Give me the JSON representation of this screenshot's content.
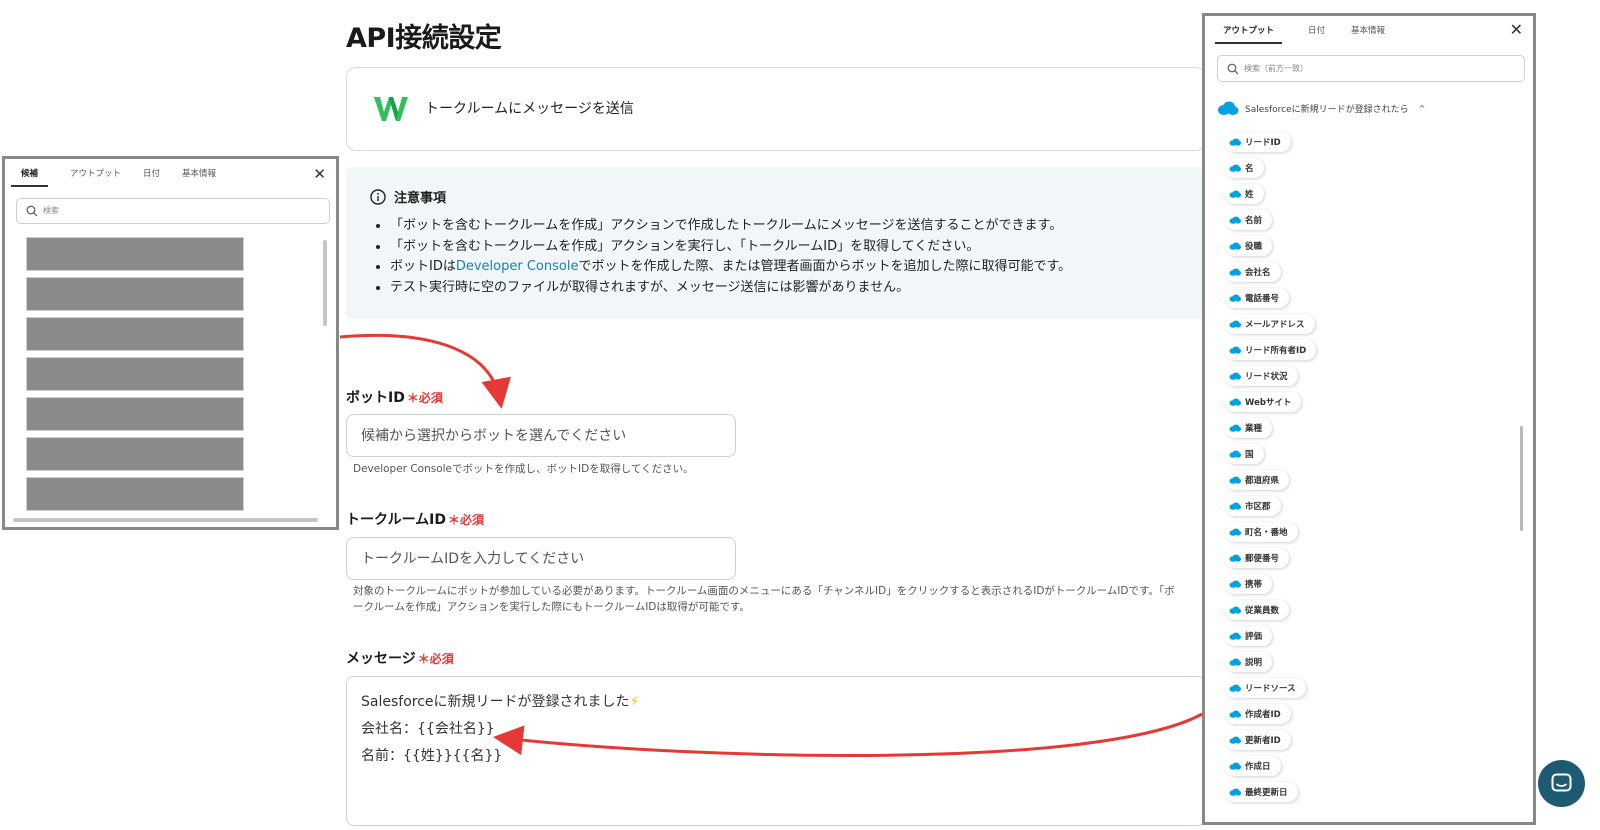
{
  "page": {
    "title": "API接続設定"
  },
  "action": {
    "label": "トークルームにメッセージを送信"
  },
  "notice": {
    "heading": "注意事項",
    "item1": "「ボットを含むトークルームを作成」アクションで作成したトークルームにメッセージを送信することができます。",
    "item2": "「ボットを含むトークルームを作成」アクションを実行し、「トークルームID」を取得してください。",
    "item3_prefix": "ボットIDは",
    "item3_link": "Developer Console",
    "item3_suffix": "でボットを作成した際、または管理者画面からボットを追加した際に取得可能です。",
    "item4": "テスト実行時に空のファイルが取得されますが、メッセージ送信には影響がありません。"
  },
  "form": {
    "bot_id": {
      "label": "ボットID",
      "required": "必須",
      "placeholder": "候補から選択からボットを選んでください",
      "hint": "Developer Consoleでボットを作成し、ボットIDを取得してください。"
    },
    "talkroom_id": {
      "label": "トークルームID",
      "required": "必須",
      "placeholder": "トークルームIDを入力してください",
      "hint_line1": "対象のトークルームにボットが参加している必要があります。トークルーム画面のメニューにある「チャンネルID」をクリックすると表示されるIDがトークルームIDです。「ボ",
      "hint_line2": "ークルームを作成」アクションを実行した際にもトークルームIDは取得が可能です。"
    },
    "message": {
      "label": "メッセージ",
      "required": "必須",
      "line1": "Salesforceに新規リードが登録されました",
      "line1_emoji": "⚡",
      "line2": "会社名：{{会社名}}",
      "line3": "名前：{{姓}}{{名}}"
    }
  },
  "left_panel": {
    "tabs": [
      "候補",
      "アウトプット",
      "日付",
      "基本情報"
    ],
    "active_tab": "候補",
    "close": "✕",
    "search_placeholder": "検索",
    "blocks": 7
  },
  "right_panel": {
    "tabs": [
      "アウトプット",
      "日付",
      "基本情報"
    ],
    "active_tab": "アウトプット",
    "close": "✕",
    "search_placeholder": "検索（前方一致）",
    "group_label": "Salesforceに新規リードが登録されたら",
    "group_chevron": "^",
    "items": [
      "リードID",
      "名",
      "姓",
      "名前",
      "役職",
      "会社名",
      "電話番号",
      "メールアドレス",
      "リード所有者ID",
      "リード状況",
      "Webサイト",
      "業種",
      "国",
      "都道府県",
      "市区郡",
      "町名・番地",
      "郵便番号",
      "携帯",
      "従業員数",
      "評価",
      "説明",
      "リードソース",
      "作成者ID",
      "更新者ID",
      "作成日",
      "最終更新日"
    ]
  },
  "colors": {
    "accent_red": "#e53935",
    "salesforce_blue": "#00a1e0",
    "link_blue": "#1a7fb8",
    "chat_bg": "#1f5a73",
    "logo_green": "#2fbf5b"
  }
}
